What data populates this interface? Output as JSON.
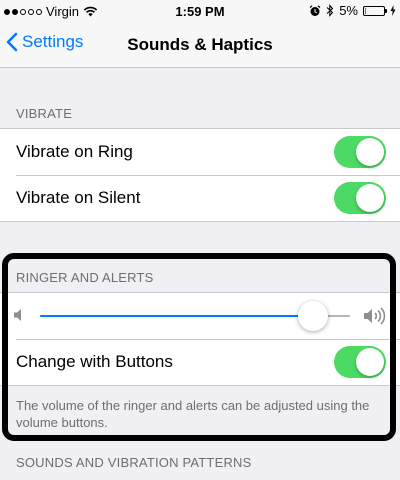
{
  "status_bar": {
    "signal_filled": 2,
    "signal_total": 5,
    "carrier": "Virgin",
    "time": "1:59 PM",
    "battery_text": "5%",
    "battery_level": 0.05,
    "battery_color": "#ff3b30"
  },
  "nav": {
    "back_label": "Settings",
    "title": "Sounds & Haptics"
  },
  "vibrate": {
    "header": "VIBRATE",
    "rows": [
      {
        "label": "Vibrate on Ring",
        "on": true
      },
      {
        "label": "Vibrate on Silent",
        "on": true
      }
    ]
  },
  "ringer": {
    "header": "RINGER AND ALERTS",
    "volume": 0.88,
    "change_with_buttons_label": "Change with Buttons",
    "change_with_buttons_on": true,
    "footer": "The volume of the ringer and alerts can be adjusted using the volume buttons."
  },
  "patterns": {
    "header": "SOUNDS AND VIBRATION PATTERNS"
  },
  "colors": {
    "accent": "#007aff",
    "toggle_on": "#4cd964",
    "background": "#efeff4"
  }
}
